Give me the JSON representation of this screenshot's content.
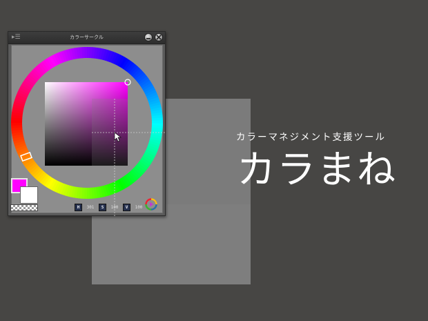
{
  "panel": {
    "title": "カラーサークル",
    "grip_glyph": "▸☰"
  },
  "colors": {
    "background": "#474644",
    "canvas_gray": "#7e7e7e",
    "foreground": "#ff00ff",
    "secondary": "#ffffff",
    "selected_hue_color": "#ff00ff"
  },
  "hsv": {
    "h_label": "H",
    "h_value": "301",
    "s_label": "S",
    "s_value": "100",
    "v_label": "V",
    "v_value": "100"
  },
  "branding": {
    "tagline": "カラーマネジメント支援ツール",
    "logo": "カラまね"
  },
  "icons": {
    "grip": "grip-icon",
    "minimize": "minimize-icon",
    "close": "close-icon",
    "color_mode": "color-mode-icon",
    "cursor": "mouse-cursor-icon"
  }
}
